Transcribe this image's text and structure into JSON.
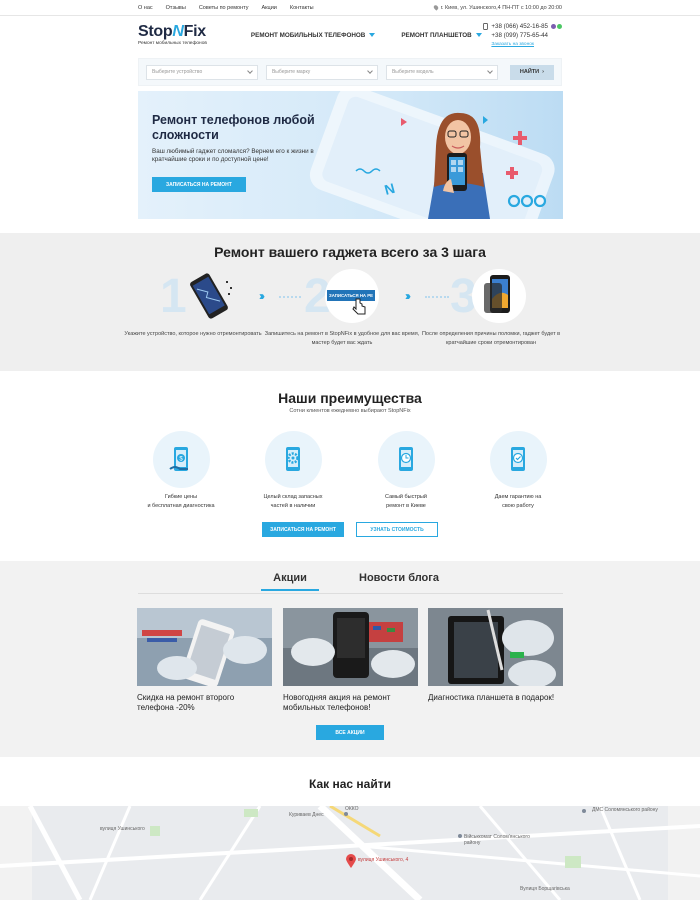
{
  "topbar": {
    "links": [
      "О нас",
      "Отзывы",
      "Советы по ремонту",
      "Акции",
      "Контакты"
    ],
    "address": "г. Киев, ул. Ушинского,4 ПН-ПТ с 10:00 до 20:00"
  },
  "header": {
    "logo_main": "Stop",
    "logo_n": "N",
    "logo_end": "Fix",
    "logo_sub": "Ремонт мобильных телефонов",
    "menu": [
      "РЕМОНТ МОБИЛЬНЫХ ТЕЛЕФОНОВ",
      "РЕМОНТ ПЛАНШЕТОВ"
    ],
    "phone1": "+38 (066) 452-16-85",
    "phone2": "+38 (099) 775-65-44",
    "callback": "Заказать на звонок"
  },
  "search": {
    "device": "Выберите устройство",
    "brand": "Выберите марку",
    "model": "Выберите модель",
    "button": "НАЙТИ"
  },
  "hero": {
    "title": "Ремонт телефонов любой сложности",
    "text": "Ваш любимый гаджет сломался? Вернем его к жизни в кратчайшие сроки и по доступной цене!",
    "button": "ЗАПИСАТЬСЯ НА РЕМОНТ"
  },
  "steps": {
    "title": "Ремонт вашего гаджета всего за 3 шага",
    "items": [
      {
        "num": "1",
        "text": "Укажите устройство, которое нужно отремонтировать"
      },
      {
        "num": "2",
        "text": "Запишитесь на ремонт в StopNFix в удобное для вас время, мастер будет вас ждать",
        "btn": "ЗАПИСАТЬСЯ НА РЕ"
      },
      {
        "num": "3",
        "text": "После определения причины поломки, гаджет будет в кратчайшие сроки отремонтирован"
      }
    ]
  },
  "advantages": {
    "title": "Наши преимущества",
    "subtitle": "Сотни клиентов ежедневно выбирают StopNFix",
    "items": [
      {
        "line1": "Гибкие цены",
        "line2": "и бесплатная диагностика",
        "icon": "money-phone-icon"
      },
      {
        "line1": "Целый склад запасных",
        "line2": "частей в наличии",
        "icon": "gear-phone-icon"
      },
      {
        "line1": "Самый быстрый",
        "line2": "ремонт в Киеве",
        "icon": "clock-phone-icon"
      },
      {
        "line1": "Даем гарантию на",
        "line2": "свою работу",
        "icon": "check-phone-icon"
      }
    ],
    "btn_primary": "ЗАПИСАТЬСЯ НА РЕМОНТ",
    "btn_secondary": "УЗНАТЬ СТОИМОСТЬ"
  },
  "promos": {
    "tabs": [
      "Акции",
      "Новости блога"
    ],
    "cards": [
      {
        "title": "Скидка на ремонт второго телефона -20%"
      },
      {
        "title": "Новогодняя акция на ремонт мобильных телефонов!"
      },
      {
        "title": "Диагностика планшета в подарок!"
      }
    ],
    "button": "ВСЕ АКЦИИ"
  },
  "findus": {
    "title": "Как нас найти"
  },
  "map": {
    "labels": [
      "ОККО",
      "Куриваев Днес",
      "ДМС Соломянського району",
      "Вiйськкомат Солом'янського району",
      "вулиця Ушинського, 4",
      "вулиця Ушинського",
      "Вулиця Борщагівська"
    ],
    "pin_label": "вулиця Ушинського, 4"
  },
  "colors": {
    "accent": "#29a8e0",
    "dark": "#1f2a44"
  }
}
